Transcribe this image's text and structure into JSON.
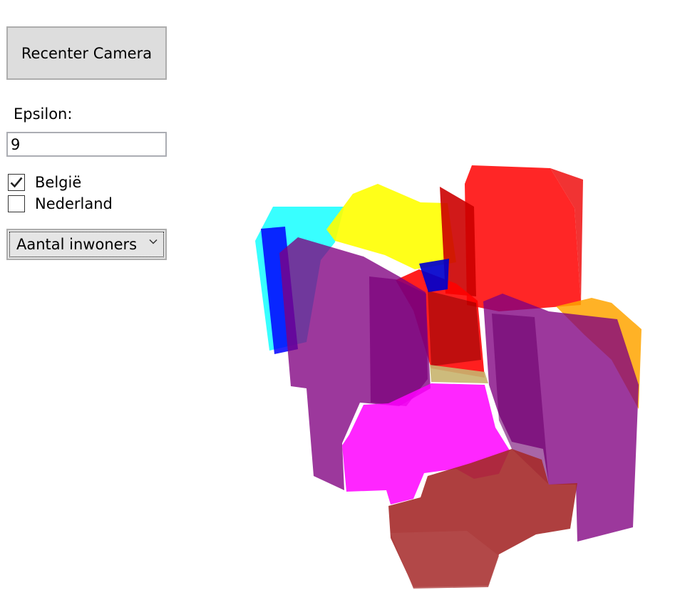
{
  "controls": {
    "recenter_label": "Recenter Camera",
    "epsilon_label": "Epsilon:",
    "epsilon_value": "9",
    "checkboxes": [
      {
        "label": "België",
        "checked": true
      },
      {
        "label": "Nederland",
        "checked": false
      }
    ],
    "metric_select": {
      "selected": "Aantal inwoners"
    }
  },
  "scene": {
    "region_colors": {
      "cyan": "#00ffff",
      "blue": "#0000ff",
      "yellow": "#ffff00",
      "red": "#ff0000",
      "orange": "#ffa500",
      "purple": "#800080",
      "magenta": "#ff00ff",
      "brown": "#a52a2a",
      "tan": "#c8b46e"
    }
  }
}
